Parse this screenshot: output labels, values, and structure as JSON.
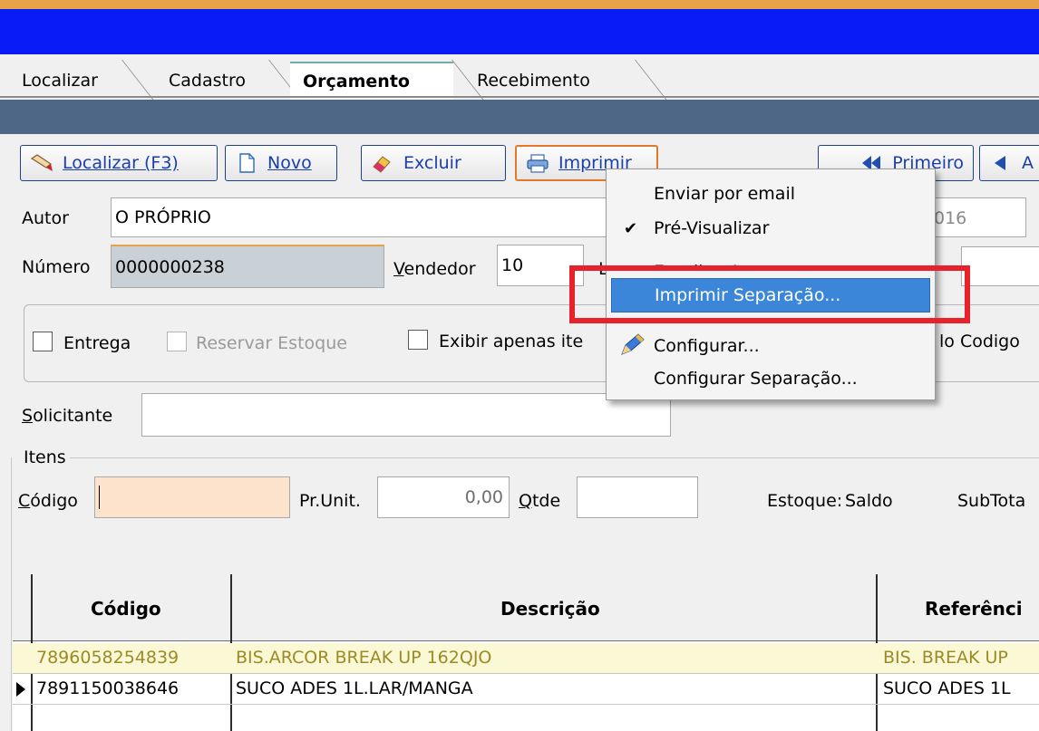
{
  "tabs": [
    {
      "label": "Localizar"
    },
    {
      "label": "Cadastro"
    },
    {
      "label": "Orçamento",
      "active": true
    },
    {
      "label": "Recebimento"
    }
  ],
  "toolbar": {
    "localizar": "Localizar (F3)",
    "novo": "Novo",
    "excluir": "Excluir",
    "imprimir": "Imprimir",
    "primeiro": "Primeiro",
    "next_partial": "A"
  },
  "form": {
    "autor_label": "Autor",
    "autor_value": "O PRÓPRIO",
    "date_partial": "016",
    "numero_label": "Número",
    "numero_value": "0000000238",
    "vendedor_label": "Vendedor",
    "vendedor_value": "10",
    "vendedor_after": "L",
    "entrega": "Entrega",
    "reservar_estoque": "Reservar Estoque",
    "exibir_apenas": "Exibir apenas ite",
    "codigo_partial": "lo Codigo",
    "solicitante_label": "Solicitante",
    "solicitante_value": "",
    "itens_legend": "Itens",
    "codigo_label": "Código",
    "codigo_value": "",
    "prunit_label": "Pr.Unit.",
    "prunit_value": "0,00",
    "qtde_label": "Qtde",
    "qtde_value": "",
    "estoque_label": "Estoque:",
    "saldo_label": "Saldo",
    "subtotal_partial": "SubTota"
  },
  "grid": {
    "headers": [
      "Código",
      "Descrição",
      "Referênci"
    ],
    "rows": [
      {
        "codigo": "7896058254839",
        "descricao": "BIS.ARCOR BREAK UP 162QJO",
        "referencia": "BIS. BREAK UP"
      },
      {
        "codigo": "7891150038646",
        "descricao": "SUCO ADES 1L.LAR/MANGA",
        "referencia": "SUCO ADES 1L"
      }
    ]
  },
  "menu": {
    "items": [
      {
        "label": "Enviar por email"
      },
      {
        "label": "Pré-Visualizar",
        "checked": true
      },
      {
        "label": "Escolher Impressora"
      },
      {
        "label": "Imprimir Separação...",
        "highlighted": true
      },
      {
        "label": "Configurar...",
        "icon": "pencil-icon"
      },
      {
        "label": "Configurar Separação..."
      }
    ]
  },
  "colors": {
    "title_bar": "#0a1cf5",
    "highlight": "#3b86d8",
    "annotation_box": "#e8222a",
    "selected_row": "#fbf8d5"
  }
}
